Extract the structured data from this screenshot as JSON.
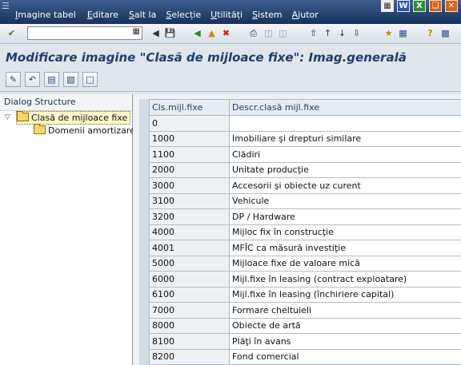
{
  "menu": [
    "Imagine tabel",
    "Editare",
    "Salt la",
    "Selecție",
    "Utilități",
    "Sistem",
    "Ajutor"
  ],
  "header_icons": [
    "sap-menu-icon",
    "word-icon",
    "excel-icon",
    "restore-icon",
    "close-window-icon"
  ],
  "toolbar": {
    "command_placeholder": "",
    "buttons": [
      "enter-icon",
      "save-icon",
      "back-icon",
      "exit-icon",
      "cancel-icon",
      "print-icon",
      "find-icon",
      "find-next-icon",
      "first-page-icon",
      "prev-page-icon",
      "next-page-icon",
      "last-page-icon",
      "create-session-icon",
      "shortcut-icon",
      "help-icon",
      "layout-icon"
    ]
  },
  "title": "Modificare imagine \"Clasă de mijloace fixe\": Imag.generală",
  "app_toolbar": [
    "change-display-icon",
    "undo-icon",
    "select-all-icon",
    "select-block-icon",
    "deselect-all-icon"
  ],
  "dialog_structure": {
    "header": "Dialog Structure",
    "nodes": [
      {
        "label": "Clasă de mijloace fixe",
        "selected": true
      },
      {
        "label": "Domenii amortizare",
        "selected": false
      }
    ]
  },
  "table": {
    "columns": [
      "Cls.mijl.fixe",
      "Descr.clasă mijl.fixe"
    ],
    "rows": [
      [
        "0",
        ""
      ],
      [
        "1000",
        "Imobiliare şi drepturi similare"
      ],
      [
        "1100",
        "Clădiri"
      ],
      [
        "2000",
        "Unitate producţie"
      ],
      [
        "3000",
        "Accesorii şi obiecte uz curent"
      ],
      [
        "3100",
        "Vehicule"
      ],
      [
        "3200",
        "DP / Hardware"
      ],
      [
        "4000",
        "Mijloc  fix în construcţie"
      ],
      [
        "4001",
        "MFÎC ca măsură investiţie"
      ],
      [
        "5000",
        "Mijloace fixe de valoare mică"
      ],
      [
        "6000",
        "Mijl.fixe în leasing (contract exploatare)"
      ],
      [
        "6100",
        "Mijl.fixe în leasing (închiriere capital)"
      ],
      [
        "7000",
        "Formare cheltuieli"
      ],
      [
        "8000",
        "Obiecte de artă"
      ],
      [
        "8100",
        "Plăţi în avans"
      ],
      [
        "8200",
        "Fond comercial"
      ]
    ]
  },
  "colors": {
    "menubar": "#16325c",
    "title": "#1e3f6e",
    "selected_node": "#fff7c9"
  }
}
